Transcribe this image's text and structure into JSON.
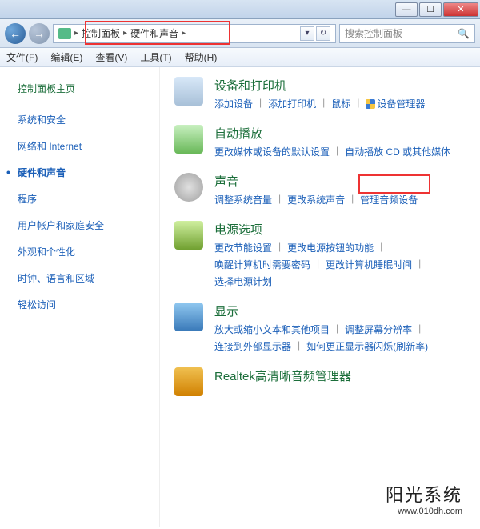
{
  "titlebar": {
    "title": ""
  },
  "breadcrumb": {
    "root": "控制面板",
    "current": "硬件和声音"
  },
  "search": {
    "placeholder": "搜索控制面板"
  },
  "menu": {
    "file": "文件(F)",
    "edit": "编辑(E)",
    "view": "查看(V)",
    "tools": "工具(T)",
    "help": "帮助(H)"
  },
  "sidebar": {
    "home": "控制面板主页",
    "items": [
      {
        "label": "系统和安全",
        "active": false
      },
      {
        "label": "网络和 Internet",
        "active": false
      },
      {
        "label": "硬件和声音",
        "active": true
      },
      {
        "label": "程序",
        "active": false
      },
      {
        "label": "用户帐户和家庭安全",
        "active": false
      },
      {
        "label": "外观和个性化",
        "active": false
      },
      {
        "label": "时钟、语言和区域",
        "active": false
      },
      {
        "label": "轻松访问",
        "active": false
      }
    ]
  },
  "sections": [
    {
      "icon": "printer-icon",
      "title": "设备和打印机",
      "links": [
        {
          "label": "添加设备",
          "shield": false
        },
        {
          "label": "添加打印机",
          "shield": false
        },
        {
          "label": "鼠标",
          "shield": false
        },
        {
          "label": "设备管理器",
          "shield": true
        }
      ]
    },
    {
      "icon": "autoplay-icon",
      "title": "自动播放",
      "links": [
        {
          "label": "更改媒体或设备的默认设置",
          "shield": false
        },
        {
          "label": "自动播放 CD 或其他媒体",
          "shield": false
        }
      ]
    },
    {
      "icon": "sound-icon",
      "title": "声音",
      "links": [
        {
          "label": "调整系统音量",
          "shield": false
        },
        {
          "label": "更改系统声音",
          "shield": false
        },
        {
          "label": "管理音频设备",
          "shield": false
        }
      ]
    },
    {
      "icon": "power-icon",
      "title": "电源选项",
      "links": [
        {
          "label": "更改节能设置",
          "shield": false
        },
        {
          "label": "更改电源按钮的功能",
          "shield": false
        },
        {
          "label": "唤醒计算机时需要密码",
          "shield": false
        },
        {
          "label": "更改计算机睡眠时间",
          "shield": false
        },
        {
          "label": "选择电源计划",
          "shield": false
        }
      ]
    },
    {
      "icon": "display-icon",
      "title": "显示",
      "links": [
        {
          "label": "放大或缩小文本和其他项目",
          "shield": false
        },
        {
          "label": "调整屏幕分辨率",
          "shield": false
        },
        {
          "label": "连接到外部显示器",
          "shield": false
        },
        {
          "label": "如何更正显示器闪烁(刷新率)",
          "shield": false
        }
      ]
    },
    {
      "icon": "realtek-icon",
      "title": "Realtek高清晰音频管理器",
      "links": []
    }
  ],
  "watermark": {
    "text": "阳光系统",
    "url": "www.010dh.com"
  }
}
